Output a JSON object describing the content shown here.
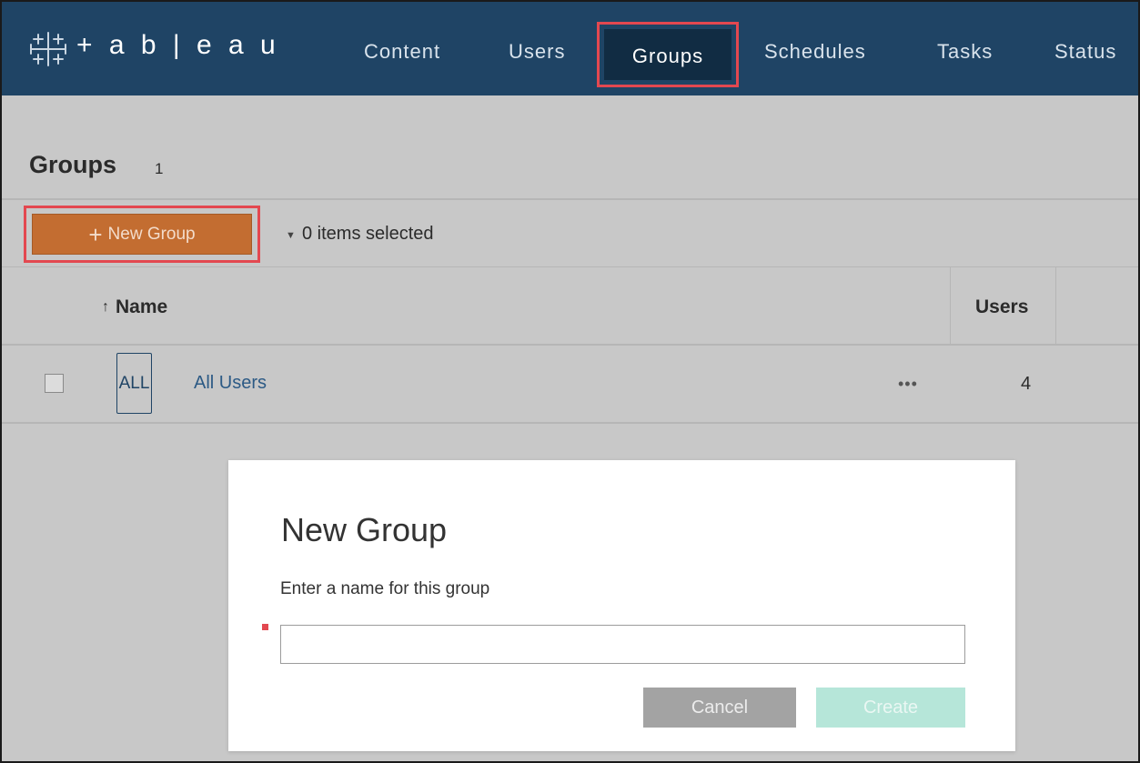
{
  "header": {
    "logo_text": "+ a b | e a u",
    "nav": {
      "content": "Content",
      "users": "Users",
      "groups": "Groups",
      "schedules": "Schedules",
      "tasks": "Tasks",
      "status": "Status"
    },
    "active_tab": "Groups"
  },
  "page": {
    "title": "Groups",
    "count": "1"
  },
  "toolbar": {
    "new_group_label": "New Group",
    "selection_text": "0 items selected"
  },
  "table": {
    "columns": {
      "name": "Name",
      "users": "Users"
    },
    "rows": [
      {
        "avatar": "ALL",
        "name": "All Users",
        "more": "•••",
        "users": "4"
      }
    ]
  },
  "dialog": {
    "title": "New Group",
    "prompt": "Enter a name for this group",
    "input_value": "",
    "cancel_label": "Cancel",
    "create_label": "Create"
  },
  "colors": {
    "nav_bg": "#1f4465",
    "nav_active_bg": "#112c43",
    "highlight": "#e34850",
    "new_group_bg": "#c36d31",
    "link": "#2c5a85",
    "cancel_bg": "#a3a3a3",
    "create_bg": "#b6e6d9"
  }
}
